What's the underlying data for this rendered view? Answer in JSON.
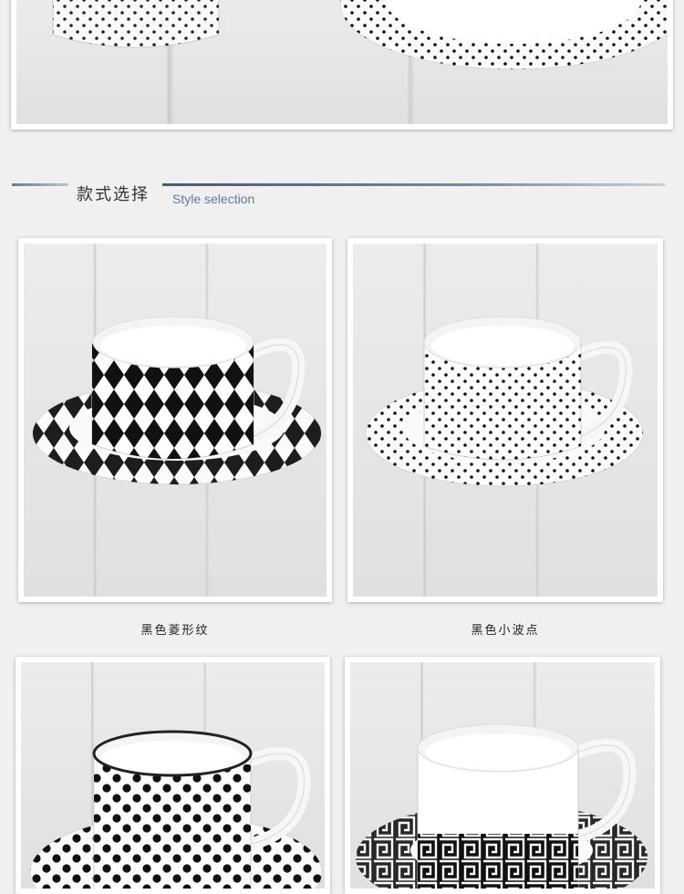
{
  "section_header": {
    "title_cn": "款式选择",
    "title_en": "Style selection"
  },
  "styles": [
    {
      "caption": "黑色菱形纹",
      "pattern": "diamond"
    },
    {
      "caption": "黑色小波点",
      "pattern": "small-dot"
    },
    {
      "caption": "",
      "pattern": "large-dot"
    },
    {
      "caption": "",
      "pattern": "greek-key"
    }
  ],
  "colors": {
    "accent_line": "#5f7b99",
    "background": "#f0f0f0",
    "pattern_black": "#111111"
  }
}
